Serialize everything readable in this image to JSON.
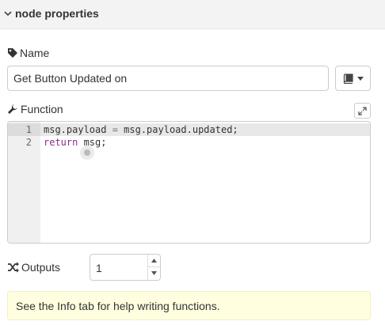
{
  "section": {
    "title": "node properties",
    "collapse_icon": "chevron-down-icon"
  },
  "name_field": {
    "label": "Name",
    "icon": "tag-icon",
    "value": "Get Button Updated on",
    "library_button_icon": "book-icon"
  },
  "function_field": {
    "label": "Function",
    "icon": "wrench-icon",
    "expand_icon": "expand-icon",
    "lines": [
      {
        "number": "1",
        "tokens": [
          "msg.payload ",
          "=",
          " msg.payload.updated;"
        ]
      },
      {
        "number": "2",
        "tokens": [
          "return",
          " msg;"
        ]
      }
    ],
    "active_line": 1
  },
  "outputs_field": {
    "label": "Outputs",
    "icon": "shuffle-icon",
    "value": "1"
  },
  "tip": {
    "text": "See the Info tab for help writing functions."
  },
  "colors": {
    "header_bg": "#f3f3f3",
    "tip_bg": "#ffffe0",
    "keyword": "#8f2a8f",
    "gutter_bg": "#f0f0f0"
  }
}
